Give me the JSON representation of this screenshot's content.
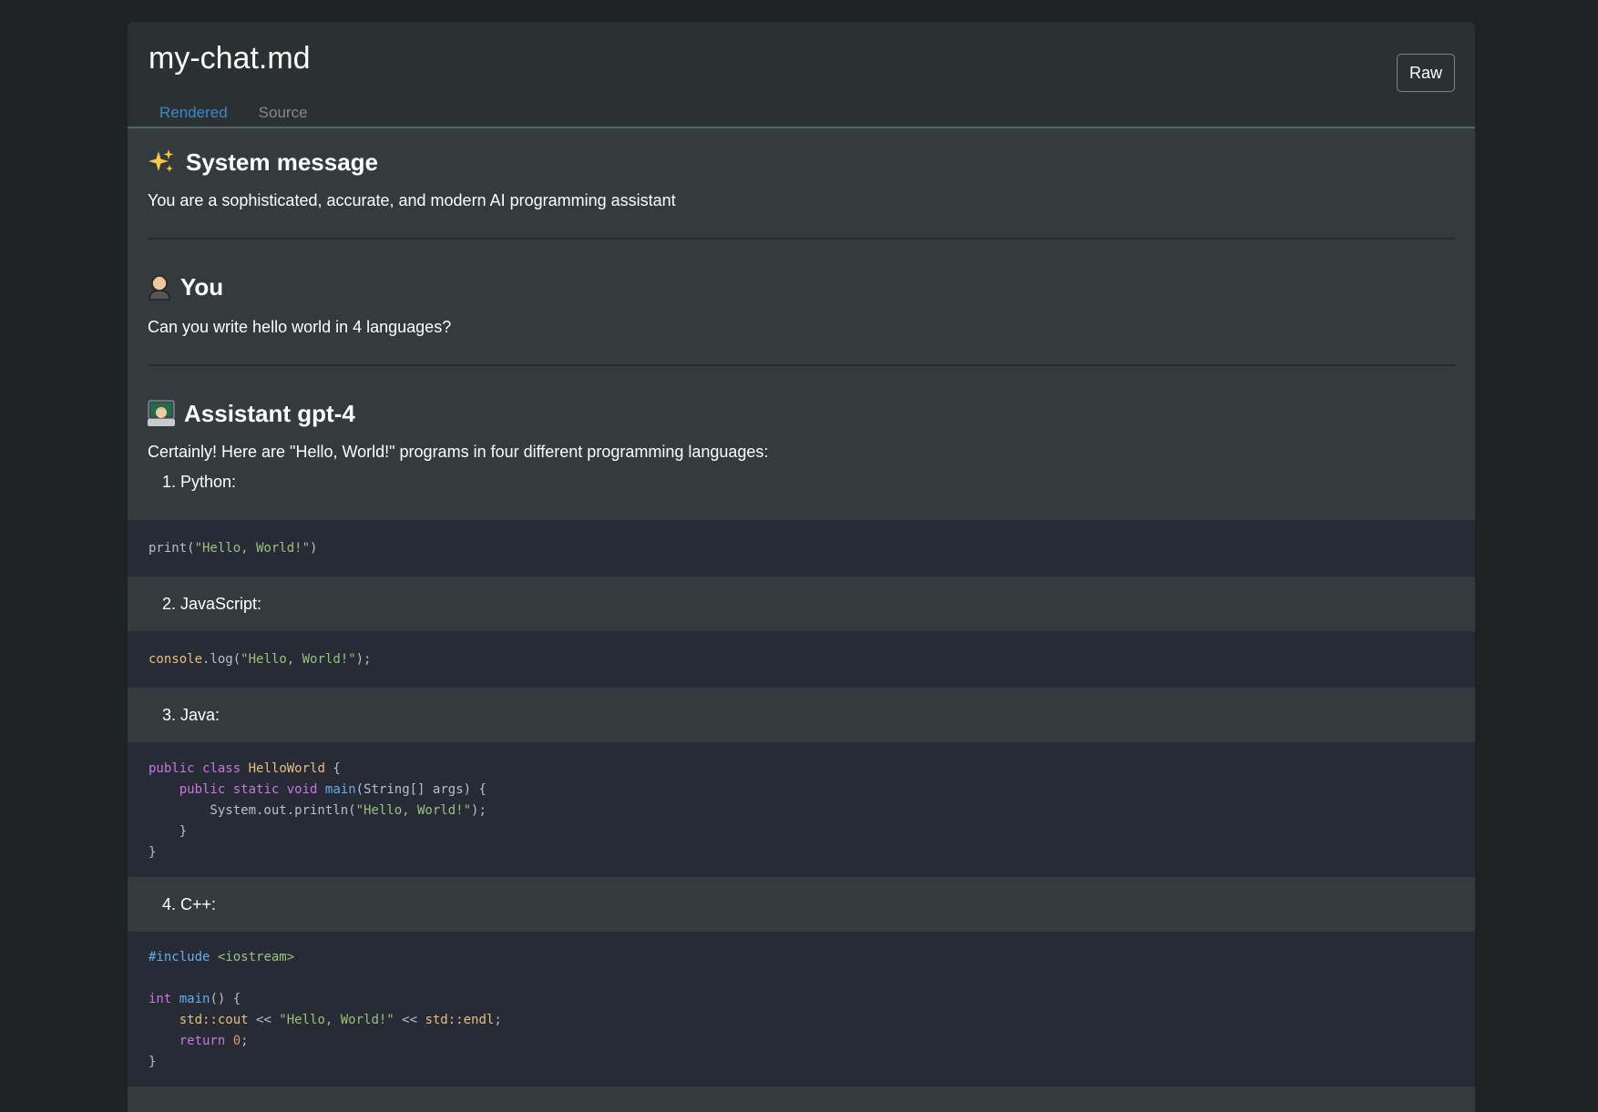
{
  "document": {
    "title": "my-chat.md",
    "raw_button": "Raw",
    "tabs": [
      {
        "label": "Rendered",
        "active": true
      },
      {
        "label": "Source",
        "active": false
      }
    ]
  },
  "messages": {
    "system": {
      "heading": "System message",
      "icon": "sparkles-icon",
      "text": "You are a sophisticated, accurate, and modern AI programming assistant"
    },
    "user": {
      "heading": "You",
      "icon": "user-icon",
      "text": "Can you write hello world in 4 languages?"
    },
    "assistant": {
      "heading": "Assistant gpt-4",
      "icon": "technologist-icon",
      "intro": "Certainly! Here are \"Hello, World!\" programs in four different programming languages:",
      "items": [
        {
          "label": "1. Python:"
        },
        {
          "label": "2. JavaScript:"
        },
        {
          "label": "3. Java:"
        },
        {
          "label": "4. C++:"
        }
      ]
    }
  },
  "code": {
    "python": "print(\"Hello, World!\")",
    "javascript": "console.log(\"Hello, World!\");",
    "java": [
      "public class HelloWorld {",
      "    public static void main(String[] args) {",
      "        System.out.println(\"Hello, World!\");",
      "    }",
      "}"
    ],
    "cpp": [
      "#include <iostream>",
      "",
      "int main() {",
      "    std::cout << \"Hello, World!\" << std::endl;",
      "    return 0;",
      "}"
    ]
  },
  "colors": {
    "accent": "#3a88d0",
    "page_bg": "#1e2223",
    "panel_bg": "#343b3c",
    "code_bg": "#272b36"
  }
}
